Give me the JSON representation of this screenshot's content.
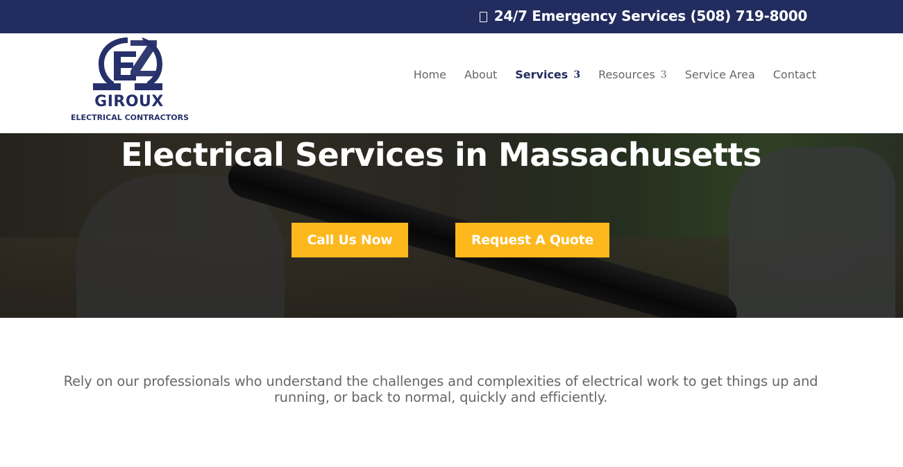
{
  "topbar": {
    "emergency_text": "24/7 Emergency Services (508) 719-8000",
    "icon": "phone-icon"
  },
  "logo": {
    "brand": "GIROUX",
    "subtitle": "ELECTRICAL CONTRACTORS"
  },
  "nav": {
    "items": [
      {
        "label": "Home"
      },
      {
        "label": "About"
      },
      {
        "label": "Services",
        "caret": "3",
        "active": true
      },
      {
        "label": "Resources",
        "caret": "3"
      },
      {
        "label": "Service Area"
      },
      {
        "label": "Contact"
      }
    ]
  },
  "hero": {
    "title": "Electrical Services in Massachusetts",
    "call_label": "Call Us Now",
    "quote_label": "Request A Quote"
  },
  "tagline": "Rely on our professionals who understand the challenges and complexities of electrical work to get things up and running, or back to normal, quickly and efficiently.",
  "colors": {
    "navy": "#222c5e",
    "accent": "#fdb81e",
    "text_gray": "#666666"
  }
}
